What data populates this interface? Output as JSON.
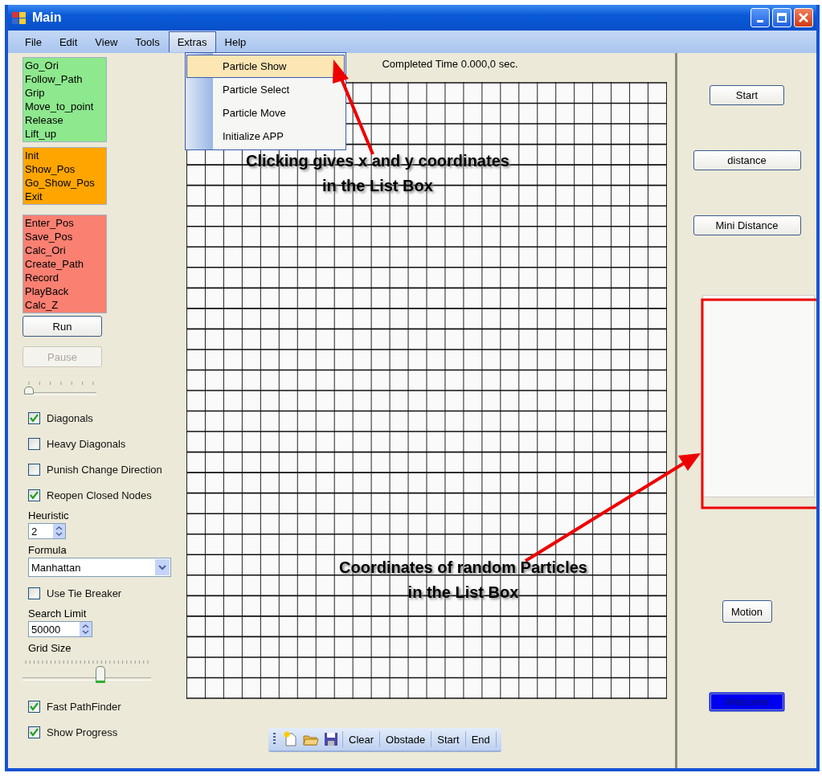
{
  "window": {
    "title": "Main"
  },
  "menu": [
    {
      "label": "File",
      "selected": false
    },
    {
      "label": "Edit",
      "selected": false
    },
    {
      "label": "View",
      "selected": false
    },
    {
      "label": "Tools",
      "selected": false
    },
    {
      "label": "Extras",
      "selected": true
    },
    {
      "label": "Help",
      "selected": false
    }
  ],
  "extras_menu": [
    {
      "label": "Particle Show",
      "selected": true
    },
    {
      "label": "Particle Select",
      "selected": false
    },
    {
      "label": "Particle Move",
      "selected": false
    },
    {
      "label": "Initialize APP",
      "selected": false
    }
  ],
  "command_lists": [
    {
      "color": "#8ee88e",
      "items": [
        "Go_Ori",
        "Follow_Path",
        "Grip",
        "Move_to_point",
        "Release",
        "Lift_up"
      ]
    },
    {
      "color": "#ffa500",
      "items": [
        "Init",
        "Show_Pos",
        "Go_Show_Pos",
        "Exit"
      ]
    },
    {
      "color": "#fa8072",
      "items": [
        "Enter_Pos",
        "Save_Pos",
        "Calc_Ori",
        "Create_Path",
        "Record",
        "PlayBack",
        "Calc_Z"
      ]
    }
  ],
  "buttons": [
    {
      "label": "Run",
      "disabled": false
    },
    {
      "label": "Pause",
      "disabled": true
    }
  ],
  "options": [
    {
      "kind": "slider",
      "level": 0.03
    },
    {
      "kind": "checkbox",
      "label": "Diagonals",
      "checked": true
    },
    {
      "kind": "checkbox",
      "label": "Heavy Diagonals",
      "checked": false
    },
    {
      "kind": "checkbox",
      "label": "Punish Change Direction",
      "checked": false
    },
    {
      "kind": "checkbox",
      "label": "Reopen Closed Nodes",
      "checked": true
    },
    {
      "kind": "spinner",
      "label": "Heuristic",
      "value": "2"
    },
    {
      "kind": "dropdown",
      "label": "Formula",
      "value": "Manhattan"
    },
    {
      "kind": "checkbox",
      "label": "Use Tie Breaker",
      "checked": false
    },
    {
      "kind": "spinner",
      "label": "Search Limit",
      "value": "50000"
    },
    {
      "kind": "slider",
      "label": "Grid Size",
      "level": 0.6
    },
    {
      "kind": "checkbox",
      "label": "Fast PathFinder",
      "checked": true
    },
    {
      "kind": "checkbox",
      "label": "Show Progress",
      "checked": true
    }
  ],
  "status": "Completed Time 0.000,0 sec.",
  "toolbar": {
    "buttons": [
      "Clear",
      "Obstade",
      "Start",
      "End"
    ]
  },
  "right_panel": [
    {
      "kind": "button",
      "label": "Start"
    },
    {
      "kind": "button",
      "label": "distance"
    },
    {
      "kind": "button",
      "label": "Mini Distance"
    },
    {
      "kind": "listbox"
    },
    {
      "kind": "button",
      "label": "Motion"
    },
    {
      "kind": "highlight",
      "label": "Welcome"
    }
  ],
  "annotations": [
    {
      "lines": [
        "Clicking gives x and y coordinates",
        "in the List Box"
      ]
    },
    {
      "lines": [
        "Coordinates of random Particles",
        "in the List Box"
      ]
    }
  ]
}
